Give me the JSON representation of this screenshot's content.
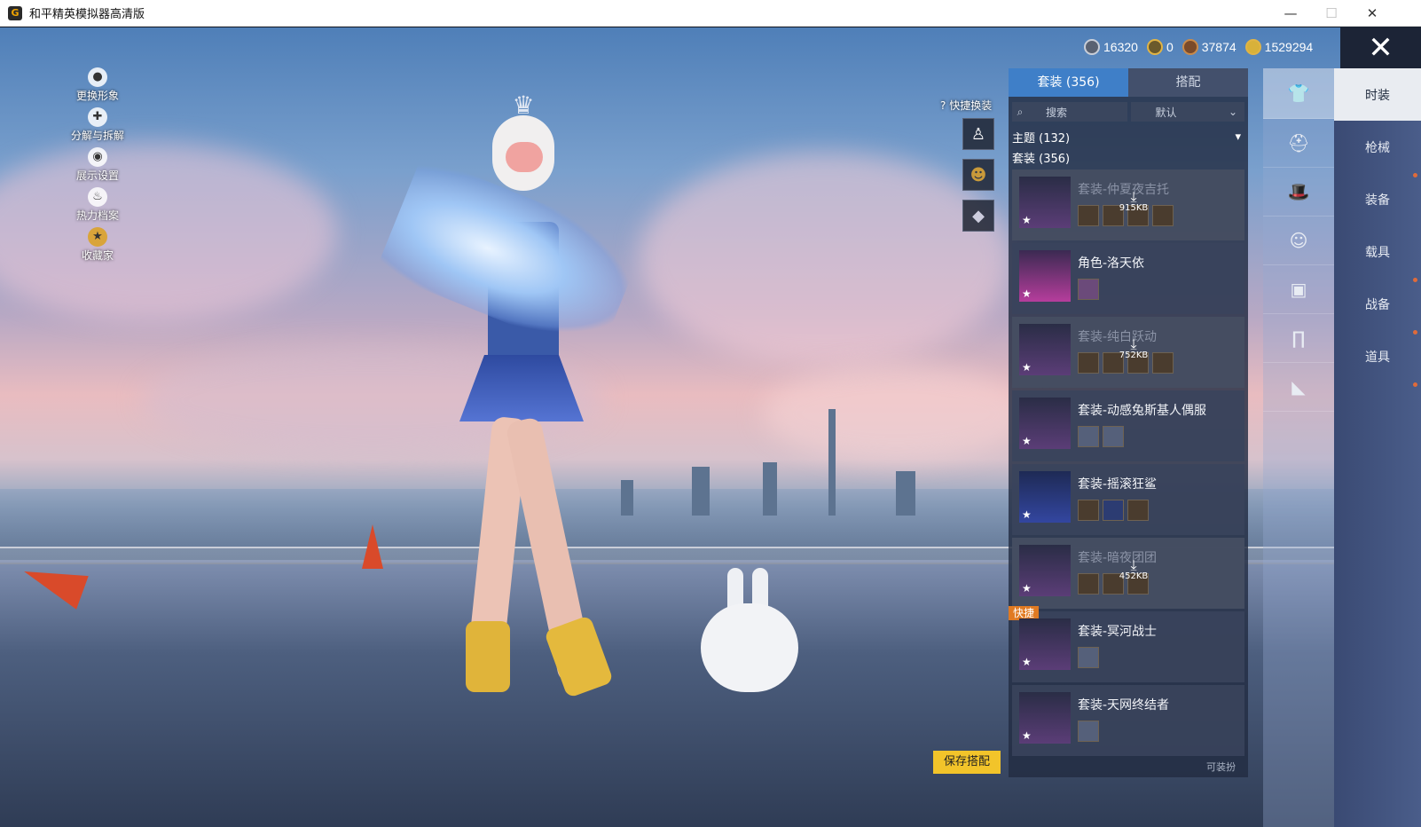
{
  "window": {
    "title": "和平精英模拟器高清版",
    "app_icon_letter": "G",
    "controls": {
      "minimize": "—",
      "maximize": "☐",
      "close": "✕"
    }
  },
  "left_menu": [
    {
      "label": "更换形象",
      "icon": "person-icon"
    },
    {
      "label": "分解与拆解",
      "icon": "puzzle-icon"
    },
    {
      "label": "展示设置",
      "icon": "eye-icon"
    },
    {
      "label": "热力档案",
      "icon": "flame-icon"
    },
    {
      "label": "收藏家",
      "icon": "medal-icon"
    }
  ],
  "currency": [
    {
      "value": "16320",
      "icon": "silver-coin-icon"
    },
    {
      "value": "0",
      "icon": "gold-badge-icon"
    },
    {
      "value": "37874",
      "icon": "bronze-coin-icon"
    },
    {
      "value": "1529294",
      "icon": "gold-coin-icon"
    }
  ],
  "close_label": "✕",
  "quick_change": {
    "title": "快捷换装",
    "help_icon": "?",
    "slots": [
      "character-slot-icon",
      "helmet-slot-icon",
      "diamond-slot-icon"
    ]
  },
  "panel": {
    "tabs": [
      {
        "label": "套装 (356)",
        "active": true
      },
      {
        "label": "搭配",
        "active": false
      }
    ],
    "search_placeholder": "搜索",
    "sort_value": "默认",
    "theme_row": "主题 (132)",
    "suit_row": "套装 (356)",
    "outfits": [
      {
        "name": "套装-仲夏夜吉托",
        "dim": true,
        "download": "915KB",
        "parts": 4
      },
      {
        "name": "角色-洛天依",
        "dim": false,
        "download": "",
        "parts": 1,
        "pink": true
      },
      {
        "name": "套装-纯白跃动",
        "dim": true,
        "download": "752KB",
        "parts": 4
      },
      {
        "name": "套装-动感兔斯基人偶服",
        "dim": false,
        "download": "",
        "parts": 2
      },
      {
        "name": "套装-摇滚狂鲨",
        "dim": false,
        "download": "",
        "parts": 3
      },
      {
        "name": "套装-暗夜团团",
        "dim": true,
        "download": "452KB",
        "parts": 3
      },
      {
        "name": "套装-冥河战士",
        "dim": false,
        "download": "",
        "parts": 1,
        "tag": "快捷"
      },
      {
        "name": "套装-天网终结者",
        "dim": false,
        "download": "",
        "parts": 1
      }
    ],
    "bottom_hint": "可装扮"
  },
  "save_button": "保存搭配",
  "categories": [
    {
      "icon": "outfit-icon",
      "active": true
    },
    {
      "icon": "helmet-icon",
      "active": false
    },
    {
      "icon": "hat-icon",
      "active": false
    },
    {
      "icon": "mask-icon",
      "active": false
    },
    {
      "icon": "top-icon",
      "active": false
    },
    {
      "icon": "pants-icon",
      "active": false
    },
    {
      "icon": "shoes-icon",
      "active": false
    }
  ],
  "right_tabs": [
    {
      "label": "时装",
      "active": true
    },
    {
      "label": "枪械",
      "active": false
    },
    {
      "label": "装备",
      "active": false
    },
    {
      "label": "载具",
      "active": false
    },
    {
      "label": "战备",
      "active": false
    },
    {
      "label": "道具",
      "active": false
    }
  ]
}
